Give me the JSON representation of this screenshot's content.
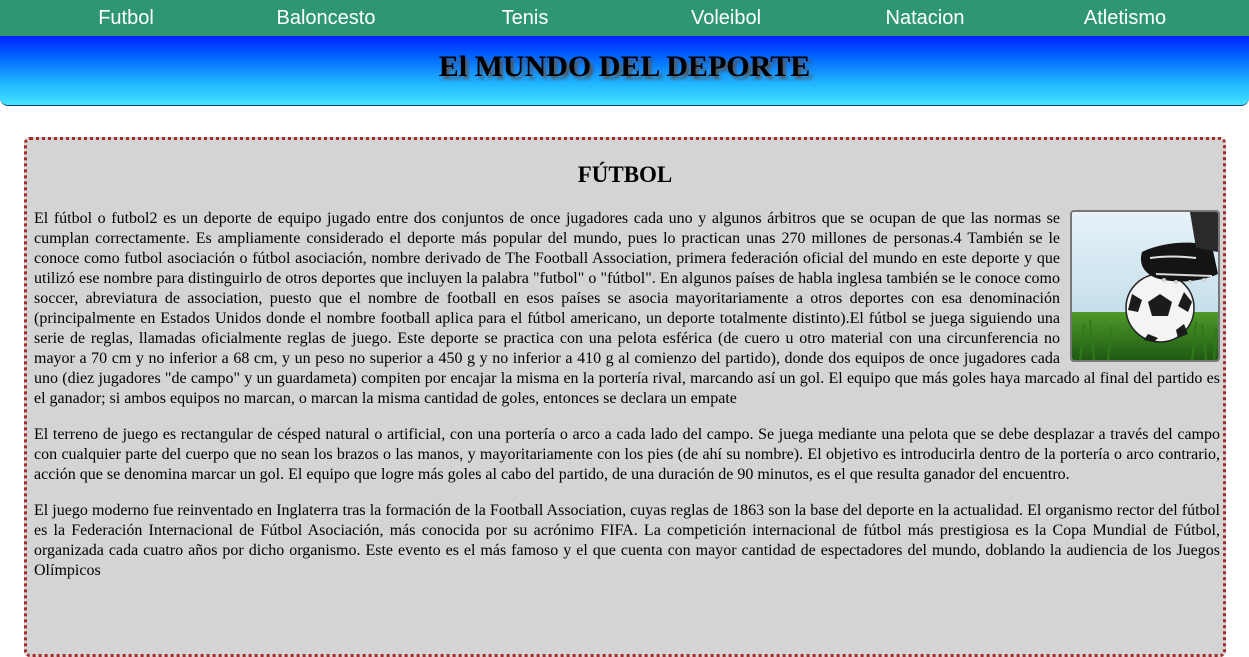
{
  "nav": {
    "items": [
      "Futbol",
      "Baloncesto",
      "Tenis",
      "Voleibol",
      "Natacion",
      "Atletismo"
    ]
  },
  "banner": {
    "title": "El MUNDO DEL DEPORTE"
  },
  "article": {
    "heading": "FÚTBOL",
    "image": {
      "icon": "soccer-ball-and-boot-photo"
    },
    "paragraphs": [
      "El fútbol o futbol2 es un deporte de equipo jugado entre dos conjuntos de once jugadores cada uno y algunos árbitros que se ocupan de que las normas se cumplan correctamente. Es ampliamente considerado el deporte más popular del mundo, pues lo practican unas 270 millones de personas.4 También se le conoce como futbol asociación o fútbol asociación, nombre derivado de The Football Association, primera federación oficial del mundo en este deporte y que utilizó ese nombre para distinguirlo de otros deportes que incluyen la palabra \"futbol\" o \"fútbol\". En algunos países de habla inglesa también se le conoce como soccer, abreviatura de association, puesto que el nombre de football en esos países se asocia mayoritariamente a otros deportes con esa denominación (principalmente en Estados Unidos donde el nombre football aplica para el fútbol americano, un deporte totalmente distinto).El fútbol se juega siguiendo una serie de reglas, llamadas oficialmente reglas de juego. Este deporte se practica con una pelota esférica (de cuero u otro material con una circunferencia no mayor a 70 cm y no inferior a 68 cm, y un peso no superior a 450 g y no inferior a 410 g al comienzo del partido), donde dos equipos de once jugadores cada uno (diez jugadores \"de campo\" y un guardameta) compiten por encajar la misma en la portería rival, marcando así un gol. El equipo que más goles haya marcado al final del partido es el ganador; si ambos equipos no marcan, o marcan la misma cantidad de goles, entonces se declara un empate",
      "El terreno de juego es rectangular de césped natural o artificial, con una portería o arco a cada lado del campo. Se juega mediante una pelota que se debe desplazar a través del campo con cualquier parte del cuerpo que no sean los brazos o las manos, y mayoritariamente con los pies (de ahí su nombre). El objetivo es introducirla dentro de la portería o arco contrario, acción que se denomina marcar un gol. El equipo que logre más goles al cabo del partido, de una duración de 90 minutos, es el que resulta ganador del encuentro.",
      "El juego moderno fue reinventado en Inglaterra tras la formación de la Football Association, cuyas reglas de 1863 son la base del deporte en la actualidad. El organismo rector del fútbol es la Federación Internacional de Fútbol Asociación, más conocida por su acrónimo FIFA. La competición internacional de fútbol más prestigiosa es la Copa Mundial de Fútbol, organizada cada cuatro años por dicho organismo. Este evento es el más famoso y el que cuenta con mayor cantidad de espectadores del mundo, doblando la audiencia de los Juegos Olímpicos"
    ]
  }
}
